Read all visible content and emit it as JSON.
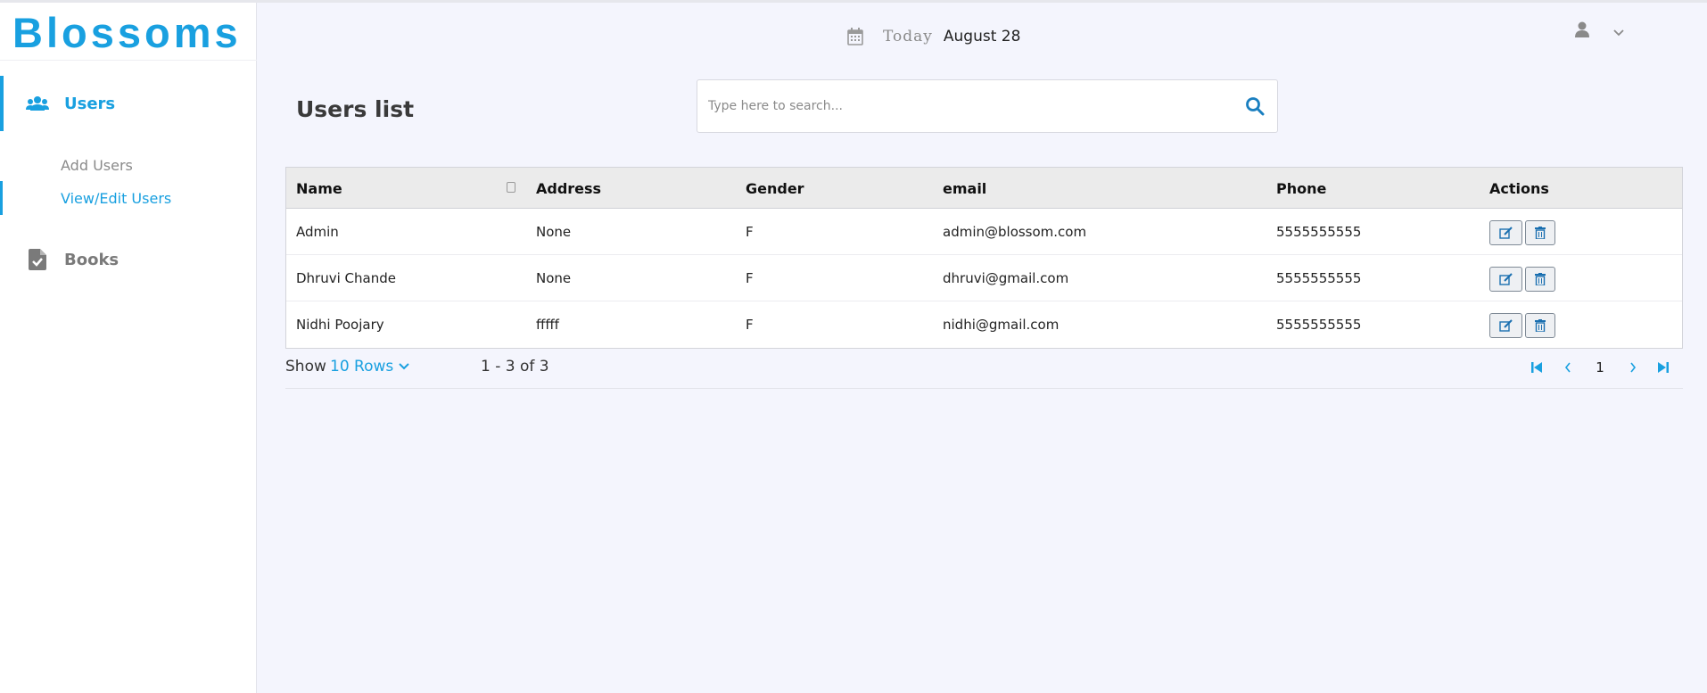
{
  "app": {
    "logo": "Blossoms"
  },
  "colors": {
    "accent": "#19a0e0",
    "background": "#f4f5fd"
  },
  "sidebar": {
    "items": [
      {
        "label": "Users",
        "icon": "users-icon",
        "active": true,
        "subitems": [
          {
            "label": "Add Users",
            "active": false
          },
          {
            "label": "View/Edit Users",
            "active": true
          }
        ]
      },
      {
        "label": "Books",
        "icon": "file-check-icon",
        "active": false
      }
    ]
  },
  "header": {
    "today_label": "Today",
    "date": "August 28",
    "calendar_icon": "calendar-icon",
    "user_icon": "user-icon",
    "menu_icon": "chevron-down-icon"
  },
  "main": {
    "title": "Users list",
    "search": {
      "placeholder": "Type here to search...",
      "value": "",
      "icon": "search-icon"
    },
    "table": {
      "columns": [
        "Name",
        "Address",
        "Gender",
        "email",
        "Phone",
        "Actions"
      ],
      "rows": [
        {
          "name": "Admin",
          "address": "None",
          "gender": "F",
          "email": "admin@blossom.com",
          "phone": "5555555555"
        },
        {
          "name": "Dhruvi Chande",
          "address": "None",
          "gender": "F",
          "email": "dhruvi@gmail.com",
          "phone": "5555555555"
        },
        {
          "name": "Nidhi Poojary",
          "address": "fffff",
          "gender": "F",
          "email": "nidhi@gmail.com",
          "phone": "5555555555"
        }
      ],
      "row_actions": [
        "edit-icon",
        "trash-icon"
      ]
    },
    "pagination": {
      "show_label": "Show",
      "rows_option": "10 Rows",
      "range": "1 - 3 of 3",
      "current_page": "1"
    }
  }
}
